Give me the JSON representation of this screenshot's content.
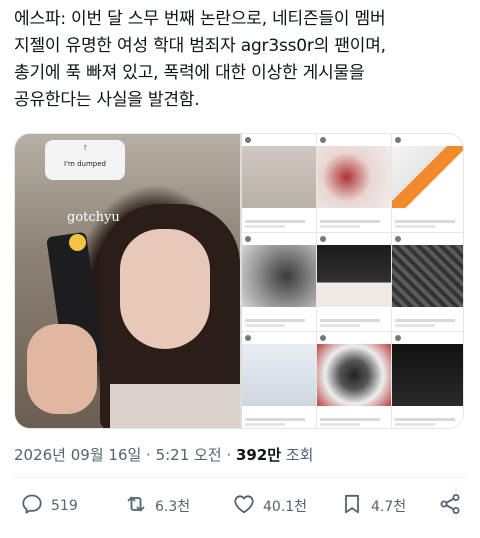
{
  "tweet": {
    "lines": [
      "에스파: 이번 달 스무 번째 논란으로, 네티즌들이 멤버",
      "지젤이 유명한 여성 학대 범죄자 agr3ss0r의 팬이며,",
      "총기에 푹 빠져 있고, 폭력에 대한 이상한 게시물을",
      "공유한다는 사실을 발견함."
    ]
  },
  "media": {
    "story_question": "?",
    "story_text": "I'm dumped",
    "sticker_text": "gotchyu"
  },
  "meta": {
    "date": "2026년 09월 16일 · 5:21 오전 · ",
    "views_number": "392만",
    "views_suffix": " 조회"
  },
  "actions": {
    "reply_count": "519",
    "retweet_count": "6.3천",
    "like_count": "40.1천",
    "bookmark_count": "4.7천"
  },
  "icons": {
    "reply": "reply-icon",
    "retweet": "retweet-icon",
    "like": "heart-icon",
    "bookmark": "bookmark-icon",
    "share": "share-icon"
  },
  "colors": {
    "text": "#0f1419",
    "muted": "#536471"
  }
}
